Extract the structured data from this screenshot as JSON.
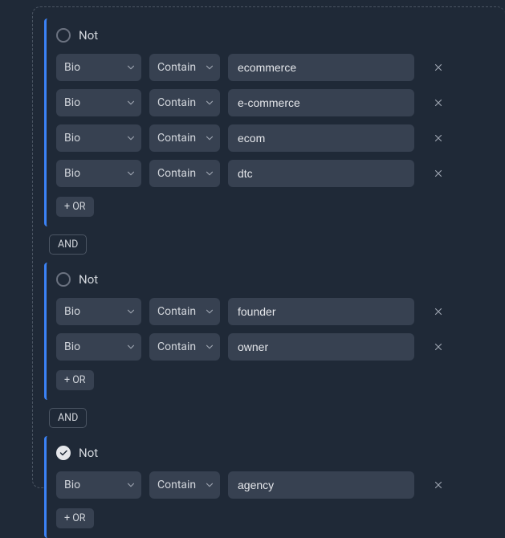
{
  "labels": {
    "not": "Not",
    "or_button": "+ OR",
    "and_badge": "AND"
  },
  "groups": [
    {
      "not_checked": false,
      "conditions": [
        {
          "field": "Bio",
          "operator": "Contain",
          "value": "ecommerce"
        },
        {
          "field": "Bio",
          "operator": "Contain",
          "value": "e-commerce"
        },
        {
          "field": "Bio",
          "operator": "Contain",
          "value": "ecom"
        },
        {
          "field": "Bio",
          "operator": "Contain",
          "value": "dtc"
        }
      ]
    },
    {
      "not_checked": false,
      "conditions": [
        {
          "field": "Bio",
          "operator": "Contain",
          "value": "founder"
        },
        {
          "field": "Bio",
          "operator": "Contain",
          "value": "owner"
        }
      ]
    },
    {
      "not_checked": true,
      "conditions": [
        {
          "field": "Bio",
          "operator": "Contain",
          "value": "agency"
        }
      ]
    }
  ]
}
